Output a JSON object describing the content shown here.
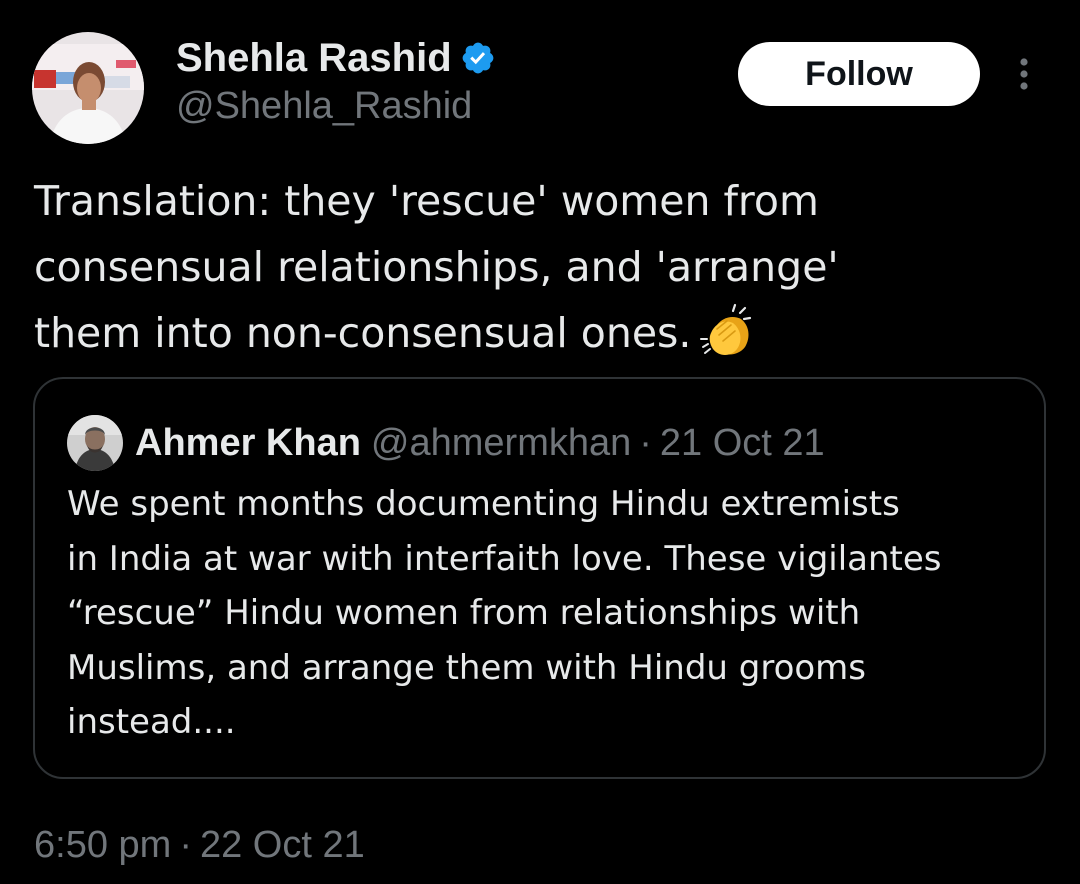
{
  "tweet": {
    "author": {
      "name": "Shehla Rashid",
      "handle": "@Shehla_Rashid",
      "verified_icon": "verified-badge-icon"
    },
    "follow_label": "Follow",
    "more_icon": "more-options-icon",
    "text_lines": [
      "Translation: they 'rescue' women from",
      "consensual relationships, and 'arrange'",
      "them into non-consensual ones."
    ],
    "emoji": "clapping-hands-icon",
    "time": "6:50 pm",
    "separator": "·",
    "date": "22 Oct 21"
  },
  "quoted": {
    "name": "Ahmer Khan",
    "handle": "@ahmermkhan",
    "separator": "·",
    "date": "21 Oct 21",
    "text_lines": [
      "We spent months documenting Hindu extremists",
      "in India at war with interfaith love. These vigilantes",
      "“rescue” Hindu women from relationships with",
      "Muslims, and arrange them with Hindu grooms",
      "instead...."
    ]
  },
  "colors": {
    "background": "#000000",
    "text_primary": "#e7e9ea",
    "text_secondary": "#71767b",
    "border": "#2f3336",
    "verified_blue": "#1d9bf0",
    "follow_bg": "#ffffff"
  }
}
